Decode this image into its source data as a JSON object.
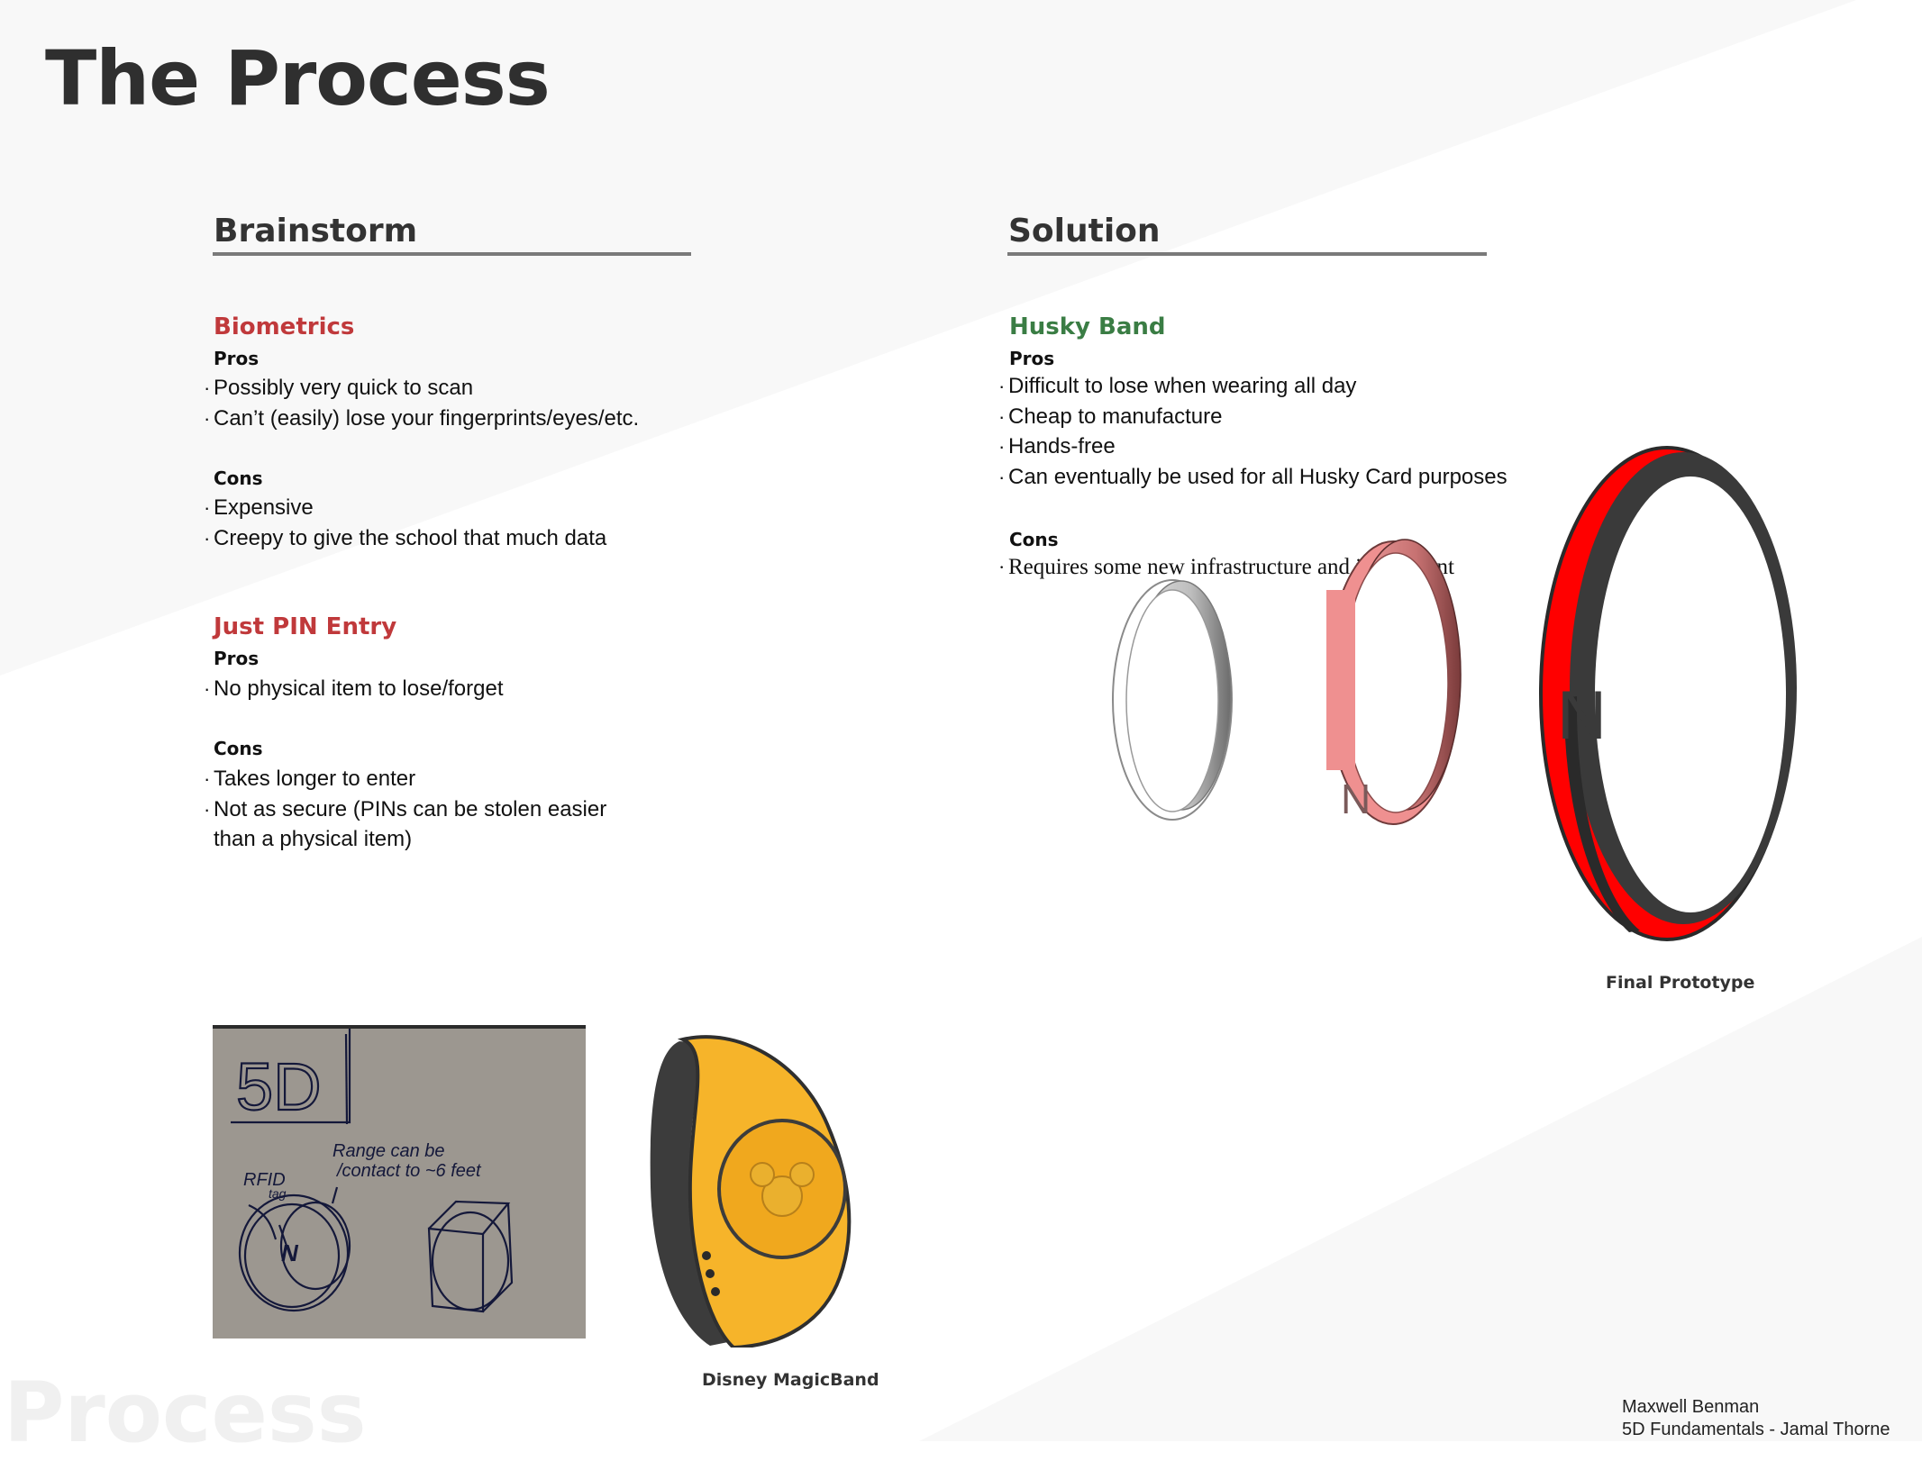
{
  "page_title": "The Process",
  "brainstorm": {
    "heading": "Brainstorm",
    "options": [
      {
        "title": "Biometrics",
        "pros_label": "Pros",
        "pros": [
          "Possibly very quick to scan",
          "Can’t (easily) lose your fingerprints/eyes/etc."
        ],
        "cons_label": "Cons",
        "cons": [
          "Expensive",
          "Creepy to give the school that much data"
        ]
      },
      {
        "title": "Just PIN Entry",
        "pros_label": "Pros",
        "pros": [
          "No physical item to lose/forget"
        ],
        "cons_label": "Cons",
        "cons": [
          "Takes longer to enter",
          "Not as secure (PINs can be stolen easier",
          "than a physical item)"
        ]
      }
    ]
  },
  "solution": {
    "heading": "Solution",
    "title": "Husky Band",
    "pros_label": "Pros",
    "pros": [
      "Difficult to lose when wearing all day",
      "Cheap to manufacture",
      "Hands-free",
      "Can eventually be used for all Husky Card purposes"
    ],
    "cons_label": "Cons",
    "cons": [
      "Requires some new infrastructure and investment"
    ]
  },
  "band_letter": "N",
  "sketch": {
    "title": "5D",
    "note_line1": "Range can be",
    "note_line2": "/contact to ~6 feet",
    "tag_line1": "RFID",
    "tag_line2": "tag",
    "band_letter": "N"
  },
  "captions": {
    "final_prototype": "Final Prototype",
    "magicband": "Disney MagicBand"
  },
  "watermark": "Process",
  "credits": {
    "author": "Maxwell Benman",
    "course": "5D Fundamentals - Jamal  Thorne"
  },
  "colors": {
    "biometrics_title": "#c0393b",
    "pin_title": "#c0393b",
    "husky_title": "#3a7d44",
    "band_red": "#ff0000",
    "band_pink": "#ef9090",
    "magicband_yellow": "#f6b42a"
  }
}
